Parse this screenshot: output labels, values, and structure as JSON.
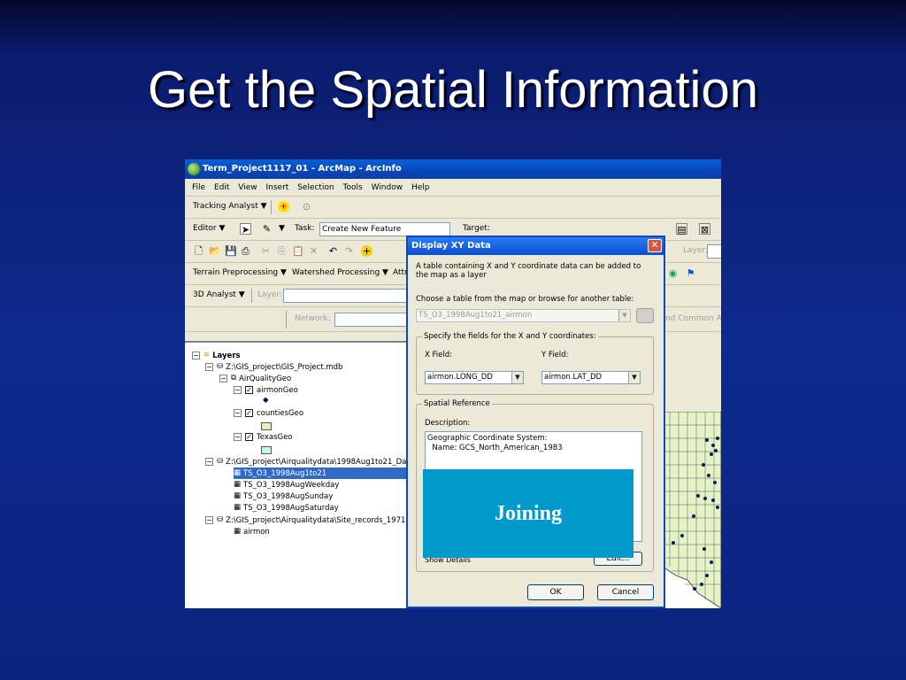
{
  "slide": {
    "title": "Get the Spatial Information"
  },
  "window": {
    "title": "Term_Project1117_01 - ArcMap - ArcInfo"
  },
  "menu": [
    "File",
    "Edit",
    "View",
    "Insert",
    "Selection",
    "Tools",
    "Window",
    "Help"
  ],
  "toolbars": {
    "tracking": {
      "label": "Tracking Analyst ▼"
    },
    "editor": {
      "label": "Editor ▼",
      "task_label": "Task:",
      "task_value": "Create New Feature",
      "target_label": "Target:"
    },
    "terrain": {
      "label": "Terrain Preprocessing ▼",
      "watershed": "Watershed Processing ▼",
      "attr": "Attr"
    },
    "analyst3d": {
      "label": "3D Analyst ▼",
      "layer_label": "Layer:"
    },
    "network": {
      "label": "Network:"
    },
    "right_layer_label": "Layer:",
    "right_common": "nd Common Ar"
  },
  "toc": {
    "root": "Layers",
    "items": [
      {
        "label": "Z:\\GIS_project\\GIS_Project.mdb"
      },
      {
        "label": "AirQualityGeo"
      },
      {
        "label": "airmonGeo"
      },
      {
        "label": "countiesGeo"
      },
      {
        "label": "TexasGeo"
      },
      {
        "label": "Z:\\GIS_project\\Airqualitydata\\1998Aug1to21_Da"
      },
      {
        "label": "TS_O3_1998Aug1to21"
      },
      {
        "label": "TS_O3_1998AugWeekday"
      },
      {
        "label": "TS_O3_1998AugSunday"
      },
      {
        "label": "TS_O3_1998AugSaturday"
      },
      {
        "label": "Z:\\GIS_project\\Airqualitydata\\Site_records_1971"
      },
      {
        "label": "airmon"
      }
    ]
  },
  "dialog": {
    "title": "Display XY Data",
    "intro": "A table containing X and Y coordinate data can be added to the map as a layer",
    "choose_label": "Choose a table from the map or browse for another table:",
    "table_value": "TS_O3_1998Aug1to21_airmon",
    "fields_group": "Specify the fields for the X and Y coordinates:",
    "x_label": "X Field:",
    "y_label": "Y Field:",
    "x_value": "airmon.LONG_DD",
    "y_value": "airmon.LAT_DD",
    "spatial_group": "Spatial Reference",
    "description_label": "Description:",
    "description_text": "Geographic Coordinate System:\n  Name: GCS_North_American_1983",
    "show_details": "Show Details",
    "edit_button": "Edit...",
    "ok": "OK",
    "cancel": "Cancel"
  },
  "overlay": {
    "label": "Joining",
    "color": "#0099cc"
  }
}
